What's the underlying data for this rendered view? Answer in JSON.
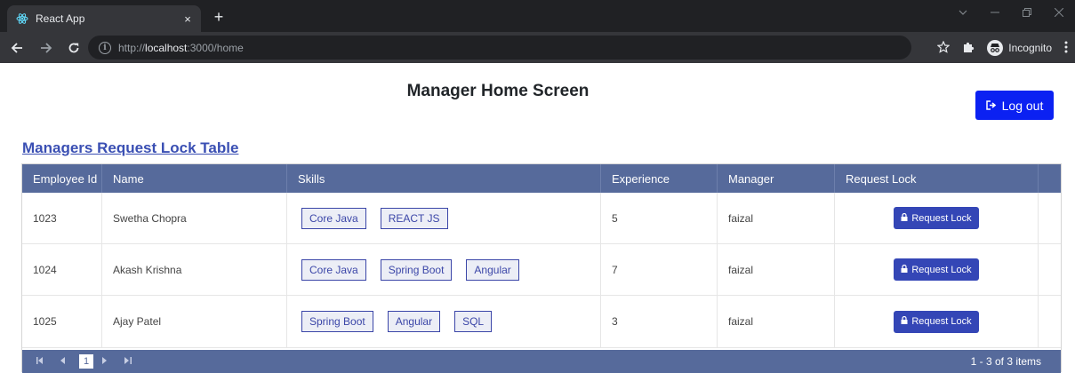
{
  "browser": {
    "tab_title": "React App",
    "tab_close": "×",
    "new_tab": "+",
    "url_prefix": "http://",
    "url_host": "localhost",
    "url_rest": ":3000/home",
    "incognito_label": "Incognito"
  },
  "page": {
    "title": "Manager Home Screen",
    "logout_label": "Log out",
    "section_title": "Managers Request Lock Table"
  },
  "table": {
    "columns": [
      "Employee Id",
      "Name",
      "Skills",
      "Experience",
      "Manager",
      "Request Lock"
    ],
    "rows": [
      {
        "id": "1023",
        "name": "Swetha Chopra",
        "skills": [
          "Core Java",
          "REACT JS"
        ],
        "experience": "5",
        "manager": "faizal",
        "action": "Request Lock"
      },
      {
        "id": "1024",
        "name": "Akash Krishna",
        "skills": [
          "Core Java",
          "Spring Boot",
          "Angular"
        ],
        "experience": "7",
        "manager": "faizal",
        "action": "Request Lock"
      },
      {
        "id": "1025",
        "name": "Ajay Patel",
        "skills": [
          "Spring Boot",
          "Angular",
          "SQL"
        ],
        "experience": "3",
        "manager": "faizal",
        "action": "Request Lock"
      }
    ]
  },
  "pager": {
    "current_page": "1",
    "info": "1 - 3 of 3 items"
  },
  "colors": {
    "header_bg": "#566a9b",
    "logout_bg": "#0b21f2",
    "request_btn_bg": "#3446b6",
    "skill_border": "#3b46a8",
    "link": "#3a4fb3"
  },
  "icons": {
    "favicon": "react-icon",
    "back": "arrow-left-icon",
    "forward": "arrow-right-icon",
    "reload": "reload-icon",
    "info": "info-icon",
    "star": "star-icon",
    "extensions": "puzzle-icon",
    "menu": "kebab-menu-icon",
    "logout": "sign-out-icon",
    "lock": "lock-icon"
  }
}
